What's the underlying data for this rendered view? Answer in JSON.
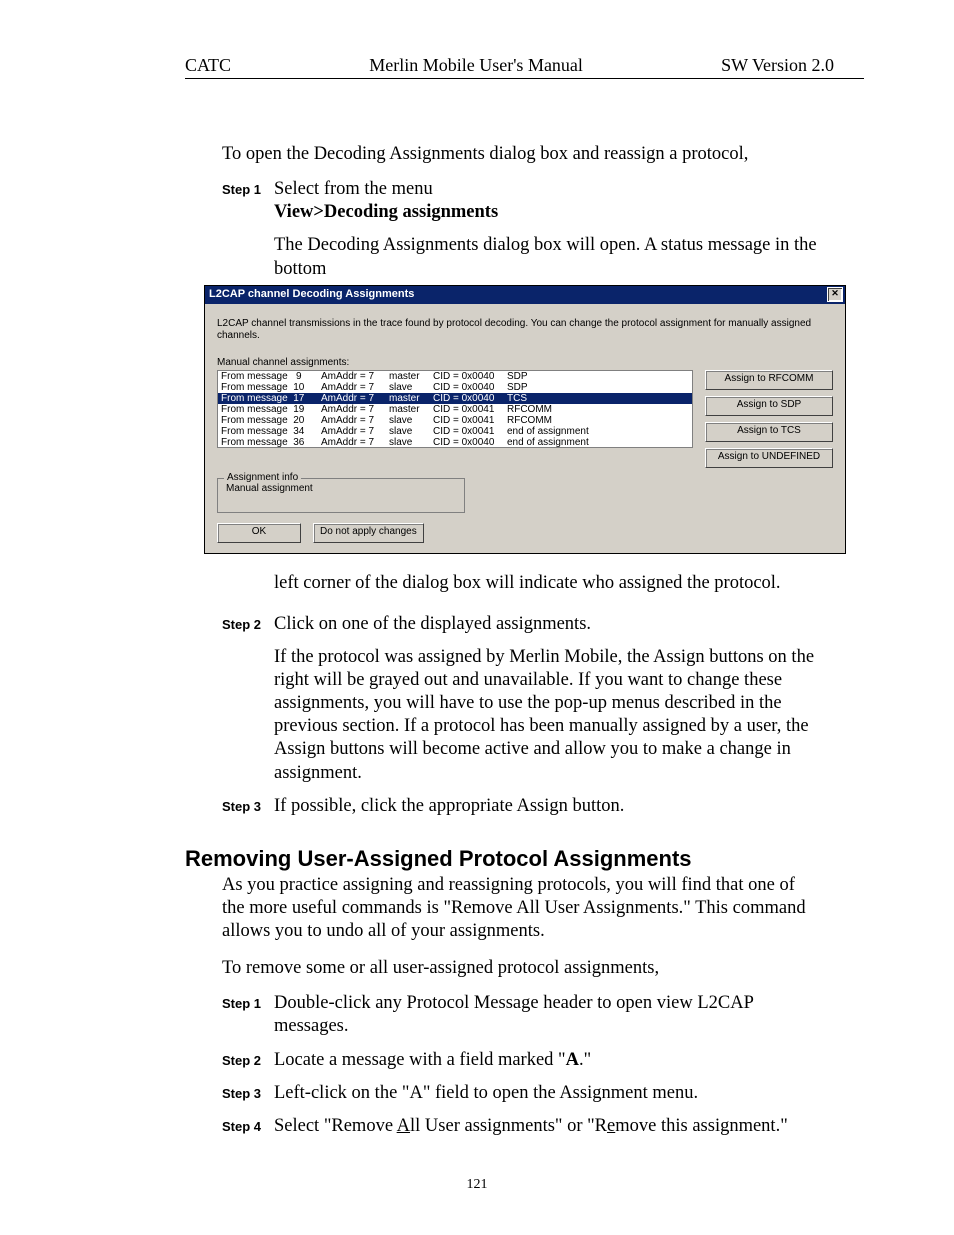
{
  "header": {
    "left": "CATC",
    "center": "Merlin Mobile User's Manual",
    "right": "SW Version 2.0"
  },
  "page_number": "121",
  "intro_para": "To open the Decoding Assignments dialog box and reassign a protocol,",
  "steps_a": [
    {
      "label": "Step 1",
      "line1": "Select from the menu",
      "menu_path": "View>Decoding assignments",
      "after": "The Decoding Assignments dialog box will open.  A status message in the bottom"
    },
    {
      "label": "Step 2",
      "text": "Click on one of the displayed assignments.",
      "after": "If the protocol was assigned by Merlin Mobile, the Assign buttons on the right will be grayed out and unavailable.  If you want to change these assignments, you will have to use the pop-up menus described in the previous section.  If a protocol has been manually assigned by a user, the Assign buttons will become active and allow you to make a change in assignment."
    },
    {
      "label": "Step 3",
      "text": "If possible, click the appropriate Assign button."
    }
  ],
  "post_dialog_text": "left corner of the dialog box will indicate who assigned the protocol.",
  "heading": "Removing User-Assigned Protocol Assignments",
  "heading_para": "As you practice assigning and reassigning protocols, you will find that one of the more useful commands is \"Remove All User Assignments.\"  This command allows you to undo all of your assignments.",
  "heading_para2": "To remove some or all user-assigned protocol assignments,",
  "steps_b": [
    {
      "label": "Step 1",
      "text": "Double-click any Protocol Message header to open view L2CAP messages."
    },
    {
      "label": "Step 2",
      "text_pre": "Locate a message with a field marked \"",
      "bold": "A",
      "text_post": ".\""
    },
    {
      "label": "Step 3",
      "text": "Left-click on the \"A\" field to open the Assignment menu."
    },
    {
      "label": "Step 4",
      "text_pre": "Select \"Remove ",
      "u1": "A",
      "mid1": "ll User assignments\" or \"R",
      "u2": "e",
      "text_post": "move this assignment.\""
    }
  ],
  "dialog": {
    "title": "L2CAP channel Decoding Assignments",
    "close_glyph": "✕",
    "intro": "L2CAP channel transmissions in the trace found by protocol decoding. You can change the protocol assignment for manually assigned channels.",
    "list_label": "Manual channel assignments:",
    "rows": [
      {
        "msg": "From message   9",
        "am": "AmAddr = 7",
        "role": "master",
        "cid": "CID = 0x0040",
        "proto": "SDP",
        "selected": false
      },
      {
        "msg": "From message  10",
        "am": "AmAddr = 7",
        "role": "slave",
        "cid": "CID = 0x0040",
        "proto": "SDP",
        "selected": false
      },
      {
        "msg": "From message  17",
        "am": "AmAddr = 7",
        "role": "master",
        "cid": "CID = 0x0040",
        "proto": "TCS",
        "selected": true
      },
      {
        "msg": "From message  19",
        "am": "AmAddr = 7",
        "role": "master",
        "cid": "CID = 0x0041",
        "proto": "RFCOMM",
        "selected": false
      },
      {
        "msg": "From message  20",
        "am": "AmAddr = 7",
        "role": "slave",
        "cid": "CID = 0x0041",
        "proto": "RFCOMM",
        "selected": false
      },
      {
        "msg": "From message  34",
        "am": "AmAddr = 7",
        "role": "slave",
        "cid": "CID = 0x0041",
        "proto": "end of assignment",
        "selected": false
      },
      {
        "msg": "From message  36",
        "am": "AmAddr = 7",
        "role": "slave",
        "cid": "CID = 0x0040",
        "proto": "end of assignment",
        "selected": false
      }
    ],
    "buttons": {
      "rfcomm": "Assign to RFCOMM",
      "sdp": "Assign to SDP",
      "tcs": "Assign to TCS",
      "undefined": "Assign to UNDEFINED"
    },
    "info_legend": "Assignment info",
    "info_text": "Manual assignment",
    "ok": "OK",
    "cancel": "Do not apply changes"
  }
}
